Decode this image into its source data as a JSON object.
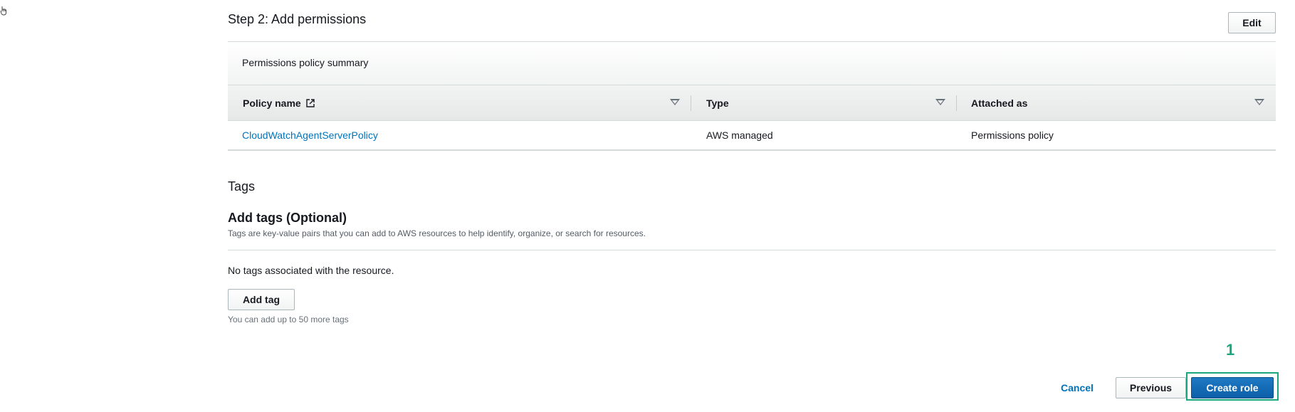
{
  "step": {
    "title": "Step 2: Add permissions",
    "edit_label": "Edit"
  },
  "permissions": {
    "panel_title": "Permissions policy summary",
    "columns": [
      "Policy name",
      "Type",
      "Attached as"
    ],
    "rows": [
      {
        "policy_name": "CloudWatchAgentServerPolicy",
        "type": "AWS managed",
        "attached_as": "Permissions policy"
      }
    ]
  },
  "tags": {
    "section_title": "Tags",
    "add_title": "Add tags (Optional)",
    "description": "Tags are key-value pairs that you can add to AWS resources to help identify, organize, or search for resources.",
    "empty_text": "No tags associated with the resource.",
    "add_tag_label": "Add tag",
    "limit_text": "You can add up to 50 more tags"
  },
  "footer": {
    "annotation_number": "1",
    "cancel_label": "Cancel",
    "previous_label": "Previous",
    "create_label": "Create role"
  },
  "icons": {
    "cursor": "hand-cursor-icon",
    "external_link": "external-link-icon",
    "sort": "sort-triangle-icon"
  },
  "colors": {
    "link": "#0073bb",
    "primary_button": "#0b5fa8",
    "annotation": "#1aa67f"
  }
}
